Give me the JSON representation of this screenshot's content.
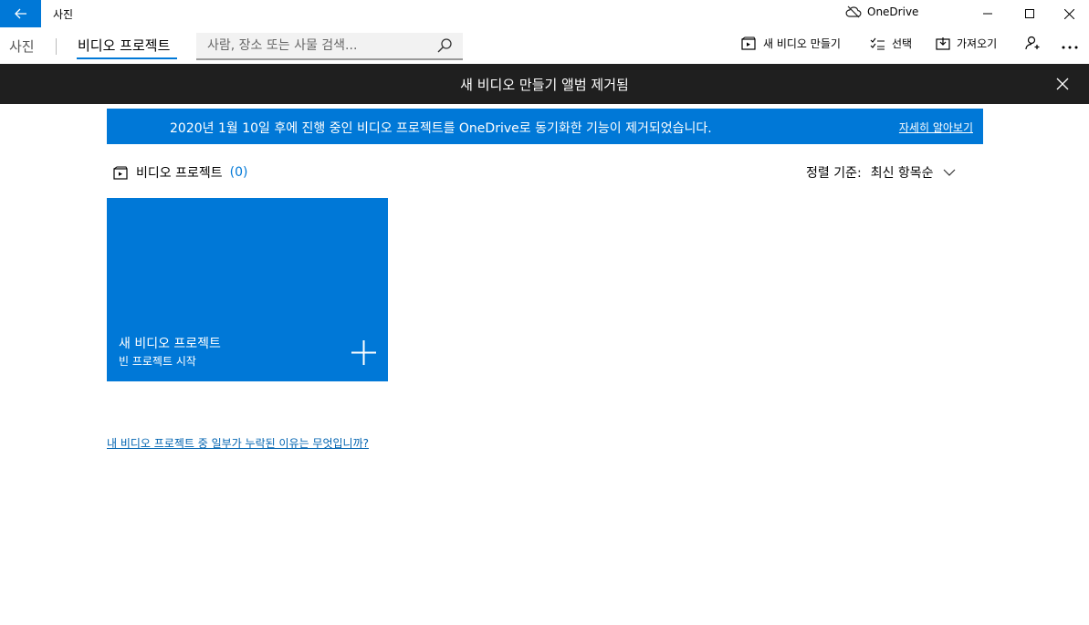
{
  "titlebar": {
    "app_title": "사진",
    "onedrive_label": "OneDrive"
  },
  "nav": {
    "photos": "사진",
    "video_projects": "비디오 프로젝트"
  },
  "search": {
    "placeholder": "사람, 장소 또는 사물 검색..."
  },
  "commands": {
    "new_video": "새 비디오 만들기",
    "select": "선택",
    "import": "가져오기"
  },
  "notification": {
    "text": "새 비디오 만들기 앨범 제거됨"
  },
  "banner": {
    "text": "2020년 1월 10일 후에 진행 중인 비디오 프로젝트를 OneDrive로 동기화한 기능이 제거되었습니다.",
    "link": "자세히 알아보기"
  },
  "section": {
    "title": "비디오 프로젝트",
    "count": "(0)",
    "sort_label": "정렬 기준:",
    "sort_value": "최신 항목순"
  },
  "tile": {
    "title": "새 비디오 프로젝트",
    "subtitle": "빈 프로젝트 시작"
  },
  "help_link": "내 비디오 프로젝트 중 일부가 누락된 이유는 무엇입니까?",
  "colors": {
    "accent": "#0078d7",
    "notification_bg": "#1f1f1f"
  }
}
